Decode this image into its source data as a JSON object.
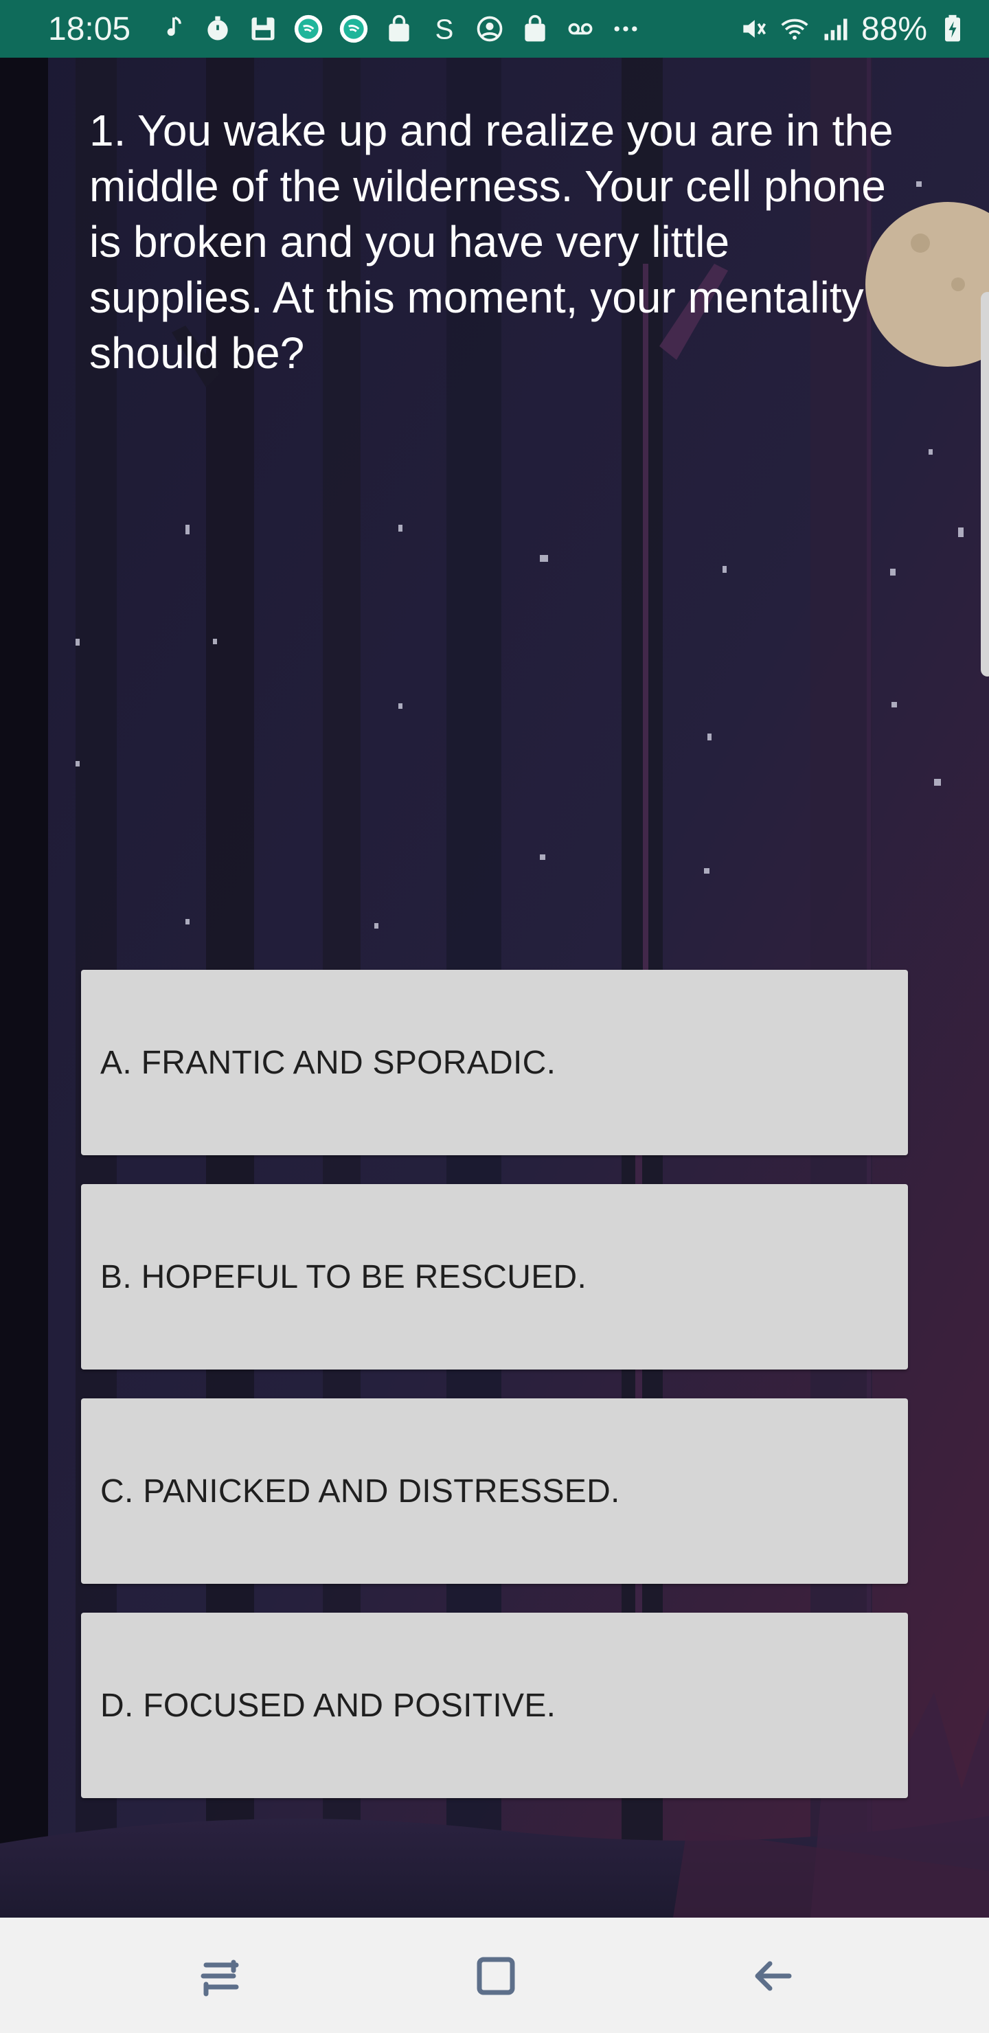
{
  "status_bar": {
    "time": "18:05",
    "battery_percent": "88%",
    "left_icons": [
      "music-note-icon",
      "timer-icon",
      "save-icon",
      "app-circle-icon",
      "app-circle-icon",
      "shopping-bag-icon",
      "s-letter-icon",
      "account-icon",
      "shopping-bag-icon",
      "voicemail-icon",
      "more-dots-icon"
    ],
    "right_icons": [
      "mute-icon",
      "wifi-icon",
      "signal-icon",
      "battery-charging-icon"
    ],
    "background_color": "#0f6b5a"
  },
  "quiz": {
    "question": "1. You wake up and realize you are in the middle of the wilderness. Your cell phone is broken and you have very little supplies. At this moment, your mentality should be?",
    "answers": [
      {
        "label": "A. FRANTIC AND SPORADIC."
      },
      {
        "label": "B. HOPEFUL TO BE RESCUED."
      },
      {
        "label": "C. PANICKED AND DISTRESSED."
      },
      {
        "label": "D. FOCUSED AND POSITIVE."
      }
    ]
  },
  "nav_bar": {
    "buttons": [
      "recent-apps-icon",
      "home-icon",
      "back-icon"
    ]
  },
  "colors": {
    "answer_background": "#d6d6d6",
    "answer_text": "#1f1f1f",
    "question_text": "#ffffff",
    "nav_background": "#f1f1f1",
    "moon": "#c9b59a"
  }
}
